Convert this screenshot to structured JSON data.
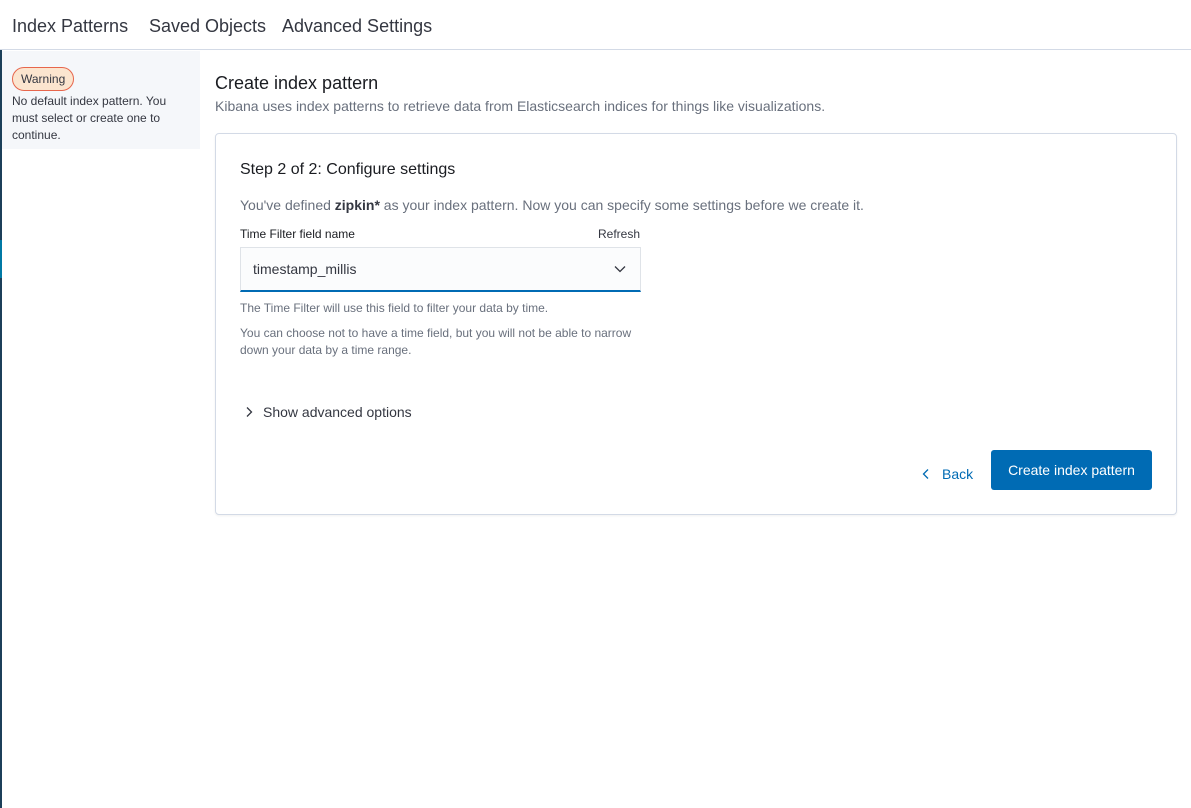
{
  "header": {
    "tabs": [
      {
        "label": "Index Patterns"
      },
      {
        "label": "Saved Objects"
      },
      {
        "label": "Advanced Settings"
      }
    ]
  },
  "sidebar": {
    "warning_badge": "Warning",
    "warning_text": "No default index pattern. You must select or create one to continue."
  },
  "main": {
    "title": "Create index pattern",
    "subtitle": "Kibana uses index patterns to retrieve data from Elasticsearch indices for things like visualizations."
  },
  "panel": {
    "step_title": "Step 2 of 2: Configure settings",
    "defined_prefix": "You've defined ",
    "defined_pattern": "zipkin*",
    "defined_suffix": " as your index pattern. Now you can specify some settings before we create it.",
    "field_label": "Time Filter field name",
    "refresh_label": "Refresh",
    "select_value": "timestamp_millis",
    "help_1": "The Time Filter will use this field to filter your data by time.",
    "help_2": "You can choose not to have a time field, but you will not be able to narrow down your data by a time range.",
    "advanced_label": "Show advanced options",
    "back_label": "Back",
    "create_label": "Create index pattern"
  },
  "colors": {
    "primary": "#006bb4",
    "warning_border": "#e7664c",
    "warning_bg": "#fbe5cf"
  }
}
